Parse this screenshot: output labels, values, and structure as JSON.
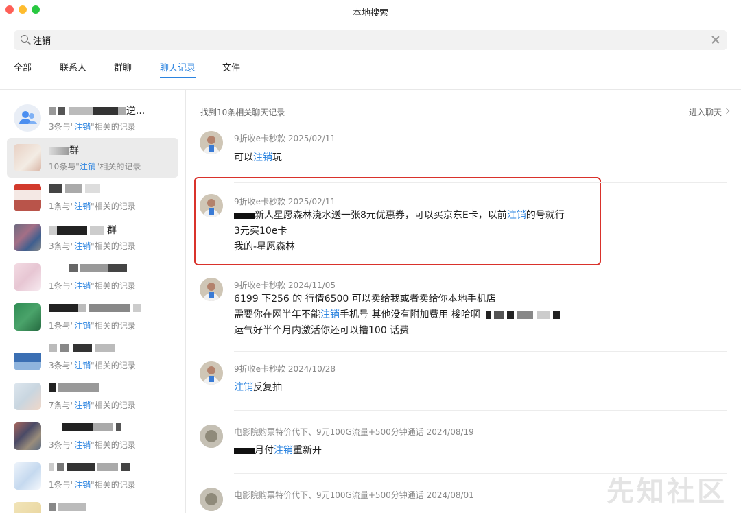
{
  "window": {
    "title": "本地搜索"
  },
  "search": {
    "value": "注销"
  },
  "tabs": [
    "全部",
    "联系人",
    "群聊",
    "聊天记录",
    "文件"
  ],
  "active_tab": "聊天记录",
  "left_list": [
    {
      "name": "逆...",
      "count_prefix": "3条与\"",
      "keyword": "注销",
      "count_suffix": "\"相关的记录"
    },
    {
      "name": "群",
      "count_prefix": "10条与\"",
      "keyword": "注销",
      "count_suffix": "\"相关的记录"
    },
    {
      "name": "",
      "count_prefix": "1条与\"",
      "keyword": "注销",
      "count_suffix": "\"相关的记录"
    },
    {
      "name": "群",
      "count_prefix": "3条与\"",
      "keyword": "注销",
      "count_suffix": "\"相关的记录"
    },
    {
      "name": "",
      "count_prefix": "1条与\"",
      "keyword": "注销",
      "count_suffix": "\"相关的记录"
    },
    {
      "name": "",
      "count_prefix": "1条与\"",
      "keyword": "注销",
      "count_suffix": "\"相关的记录"
    },
    {
      "name": "",
      "count_prefix": "3条与\"",
      "keyword": "注销",
      "count_suffix": "\"相关的记录"
    },
    {
      "name": "",
      "count_prefix": "7条与\"",
      "keyword": "注销",
      "count_suffix": "\"相关的记录"
    },
    {
      "name": "",
      "count_prefix": "3条与\"",
      "keyword": "注销",
      "count_suffix": "\"相关的记录"
    },
    {
      "name": "",
      "count_prefix": "1条与\"",
      "keyword": "注销",
      "count_suffix": "\"相关的记录"
    }
  ],
  "results": {
    "header": "找到10条相关聊天记录",
    "enter_chat": "进入聊天",
    "messages": [
      {
        "sender": "9折收e卡秒款",
        "date": "2025/02/11",
        "lines": [
          [
            "可以",
            "注销",
            "玩"
          ]
        ]
      },
      {
        "sender": "9折收e卡秒款",
        "date": "2025/02/11",
        "lines": [
          [
            "新人星愿森林浇水送一张8元优惠券，可以买京东E卡，以前",
            "注销",
            "的号就行"
          ],
          [
            "3元买10e卡",
            "",
            ""
          ],
          [
            "我的-星愿森林",
            "",
            ""
          ]
        ]
      },
      {
        "sender": "9折收e卡秒款",
        "date": "2024/11/05",
        "lines": [
          [
            "6199 下256 的 行情6500 可以卖给我或者卖给你本地手机店",
            "",
            ""
          ],
          [
            "需要你在网半年不能",
            "注销",
            "手机号 其他没有附加费用 梭哈啊"
          ],
          [
            "运气好半个月内激活你还可以撸100 话费",
            "",
            ""
          ]
        ]
      },
      {
        "sender": "9折收e卡秒款",
        "date": "2024/10/28",
        "lines": [
          [
            "",
            "注销",
            "反复抽"
          ]
        ]
      },
      {
        "sender": "电影院购票特价代下、9元100G流量+500分钟通话",
        "date": "2024/08/19",
        "lines": [
          [
            "月付",
            "注销",
            "重新开"
          ]
        ]
      },
      {
        "sender": "电影院购票特价代下、9元100G流量+500分钟通话",
        "date": "2024/08/01",
        "lines": []
      }
    ]
  },
  "watermark": "先知社区",
  "colors": {
    "accent": "#2c84e0",
    "highlight_box": "#d9322b"
  }
}
